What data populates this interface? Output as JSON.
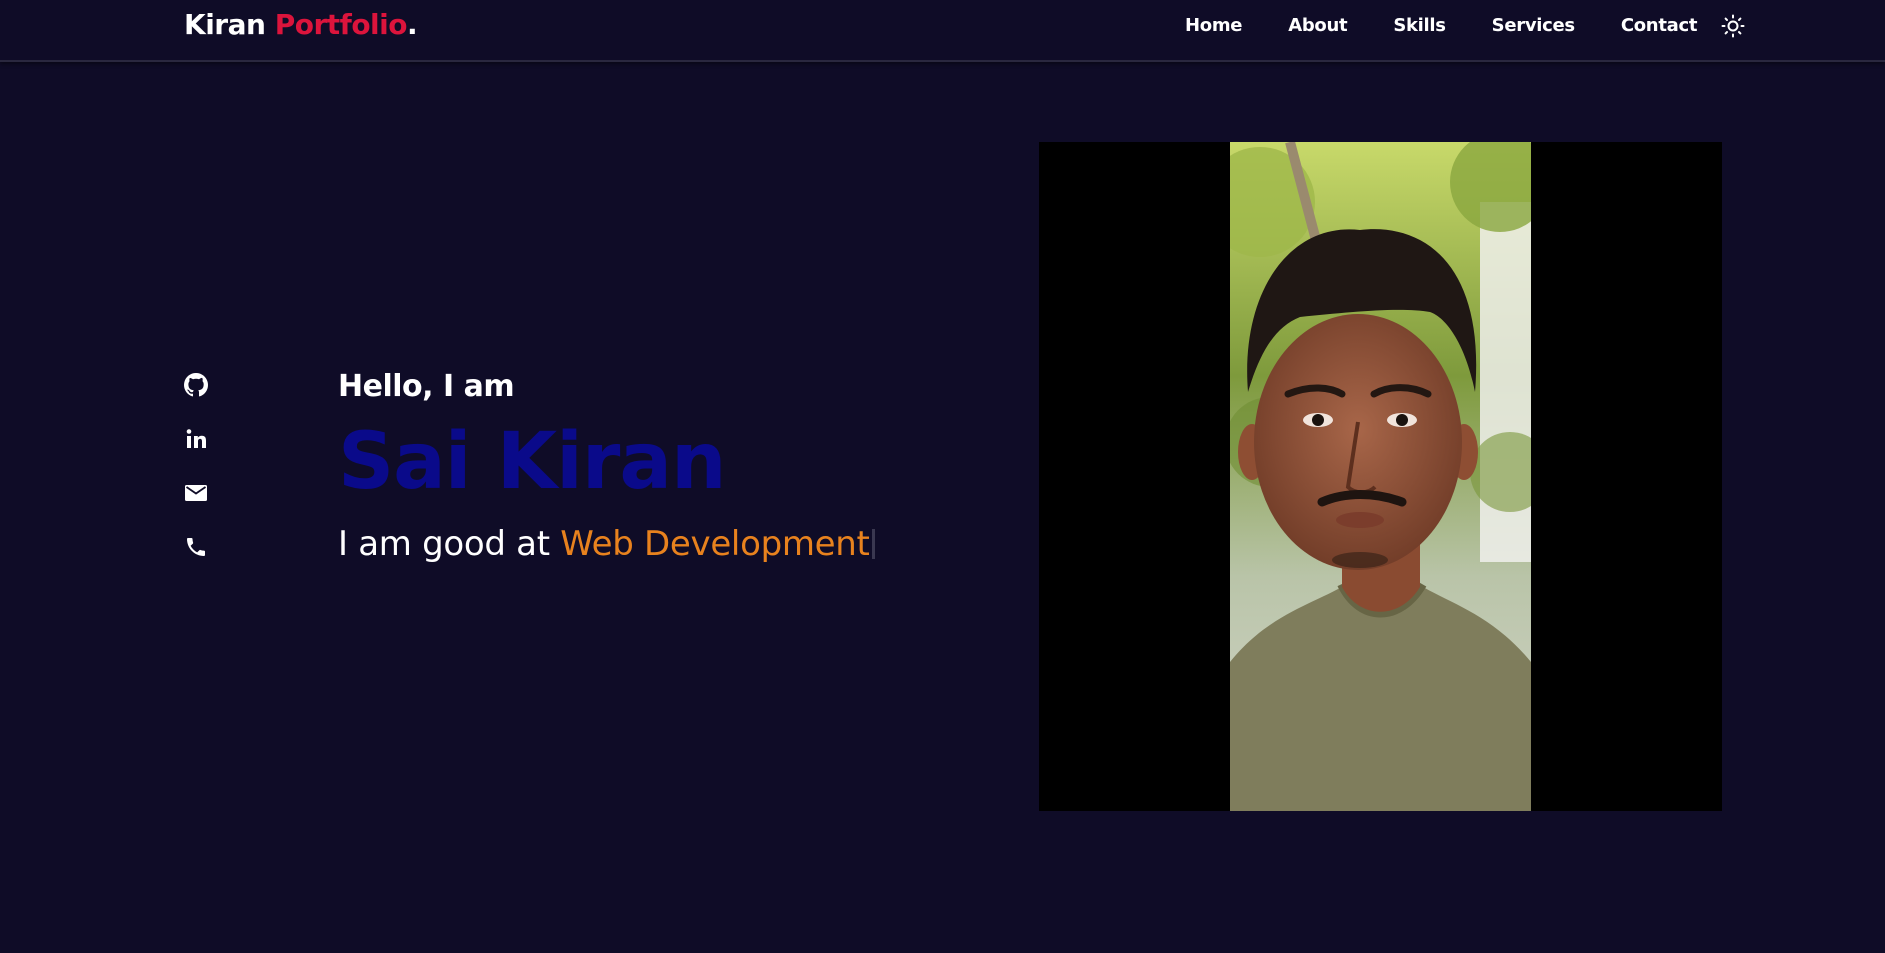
{
  "logo": {
    "primary": "Kiran",
    "accent": "Portfolio",
    "dot": "."
  },
  "nav": {
    "items": [
      "Home",
      "About",
      "Skills",
      "Services",
      "Contact"
    ],
    "theme_toggle_icon": "sun-icon"
  },
  "socials": [
    {
      "icon": "github-icon"
    },
    {
      "icon": "linkedin-icon"
    },
    {
      "icon": "mail-icon"
    },
    {
      "icon": "phone-icon"
    }
  ],
  "hero": {
    "greeting": "Hello, I am",
    "name": "Sai Kiran",
    "tagline_prefix": "I am good at",
    "tagline_skill": "Web Development"
  },
  "colors": {
    "background": "#0f0c27",
    "accent_red": "#dc143c",
    "name_blue": "#0a0a8a",
    "skill_orange": "#e8821e"
  },
  "profile_photo": {
    "alt": "portrait-photo"
  }
}
